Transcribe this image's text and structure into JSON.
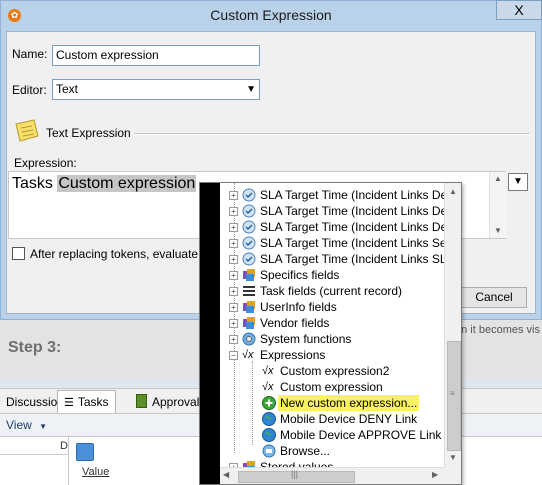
{
  "background": {
    "step_label": "Step 3:",
    "step_hint": "en it becomes vis",
    "tabs": [
      "Discussion",
      "Tasks",
      "Approvals"
    ],
    "view_label": "View",
    "grid_col_header": "D",
    "grid_value": "Value"
  },
  "dialog": {
    "title": "Custom Expression",
    "close_glyph": "X",
    "name_label": "Name:",
    "name_value": "Custom expression",
    "editor_label": "Editor:",
    "editor_value": "Text",
    "section_title": "Text Expression",
    "expression_label": "Expression:",
    "expression_prefix": "Tasks ",
    "expression_token": "Custom expression",
    "checkbox_label": "After replacing tokens, evaluate the",
    "cancel_label": "Cancel"
  },
  "tree": {
    "items": [
      {
        "label": "SLA Target Time (Incident Links Defau",
        "icon": "clock-icon"
      },
      {
        "label": "SLA Target Time (Incident Links Defau",
        "icon": "clock-icon"
      },
      {
        "label": "SLA Target Time (Incident Links Defau",
        "icon": "clock-icon"
      },
      {
        "label": "SLA Target Time (Incident Links Servi",
        "icon": "clock-icon"
      },
      {
        "label": "SLA Target Time (Incident Links SLA T",
        "icon": "clock-icon"
      },
      {
        "label": "Specifics fields",
        "icon": "cube-icon"
      },
      {
        "label": "Task fields (current record)",
        "icon": "list-icon"
      },
      {
        "label": "UserInfo fields",
        "icon": "cube-icon"
      },
      {
        "label": "Vendor fields",
        "icon": "cube-icon"
      },
      {
        "label": "System functions",
        "icon": "gear-globe-icon"
      },
      {
        "label": "Expressions",
        "icon": "sqrt-x-icon"
      },
      {
        "label": "Custom expression2",
        "icon": "sqrt-x-icon"
      },
      {
        "label": "Custom expression",
        "icon": "sqrt-x-icon"
      },
      {
        "label": "New custom expression...",
        "icon": "add-icon"
      },
      {
        "label": "Mobile Device DENY Link",
        "icon": "globe-icon"
      },
      {
        "label": "Mobile Device APPROVE Link",
        "icon": "globe-icon"
      },
      {
        "label": "Browse...",
        "icon": "browse-icon"
      },
      {
        "label": "Stored values",
        "icon": "cube-icon"
      }
    ]
  },
  "colors": {
    "title_bar": "#b9d2ea",
    "highlight": "#f9f45e",
    "token_highlight": "#c6c6c6"
  }
}
